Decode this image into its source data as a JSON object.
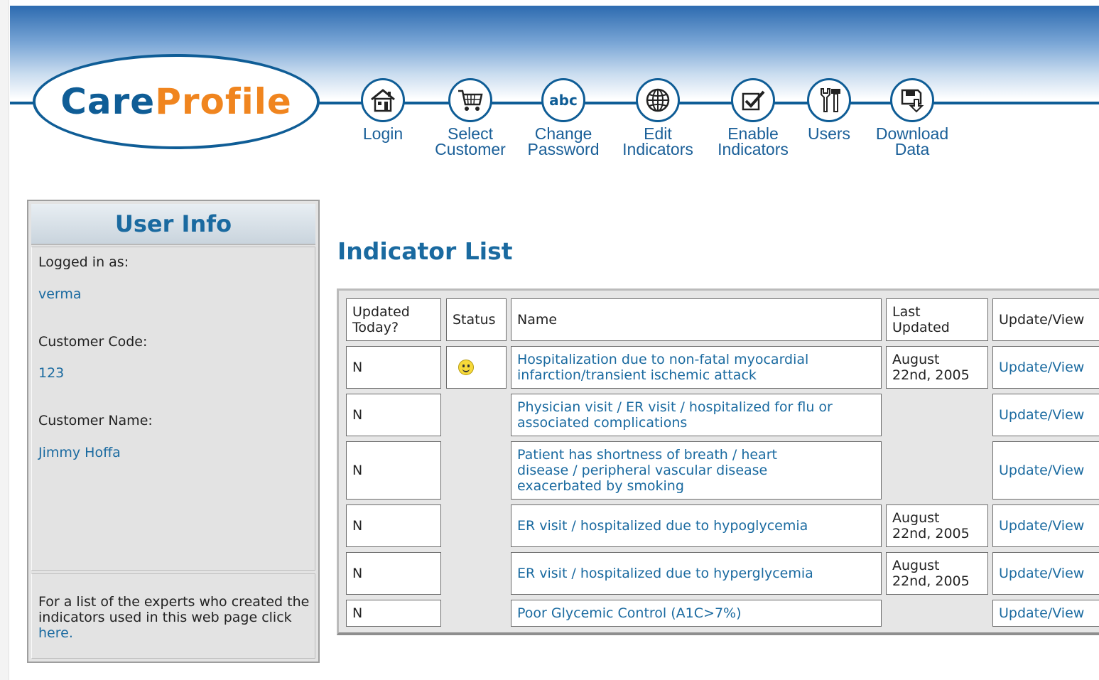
{
  "brand": {
    "part1": "Care",
    "part2": "Profile"
  },
  "nav": [
    {
      "label": "Login",
      "icon": "house-icon"
    },
    {
      "label": "Select Customer",
      "icon": "shopping-cart-icon"
    },
    {
      "label": "Change Password",
      "icon": "abc-icon"
    },
    {
      "label": "Edit Indicators",
      "icon": "globe-icon"
    },
    {
      "label": "Enable Indicators",
      "icon": "checkbox-icon"
    },
    {
      "label": "Users",
      "icon": "tools-icon"
    },
    {
      "label": "Download Data",
      "icon": "disk-download-icon"
    }
  ],
  "user_info": {
    "title": "User Info",
    "logged_in_label": "Logged in as:",
    "logged_in_value": "verma",
    "customer_code_label": "Customer Code:",
    "customer_code_value": "123",
    "customer_name_label": "Customer Name:",
    "customer_name_value": "Jimmy Hoffa",
    "footnote_text": "For a list of the experts who created the indicators used in this web page click ",
    "footnote_link": "here."
  },
  "main": {
    "title": "Indicator List",
    "columns": [
      "Updated Today?",
      "Status",
      "Name",
      "Last Updated",
      "Update/View"
    ],
    "rows": [
      {
        "updated_today": "N",
        "status": "smiley",
        "name": "Hospitalization due to non-fatal myocardial infarction/transient ischemic attack",
        "last_updated": "August 22nd, 2005",
        "action": "Update/View"
      },
      {
        "updated_today": "N",
        "status": "",
        "name": "Physician visit / ER visit / hospitalized for flu or associated complications",
        "last_updated": "",
        "action": "Update/View"
      },
      {
        "updated_today": "N",
        "status": "",
        "name": "Patient has shortness of breath / heart disease / peripheral vascular disease exacerbated by smoking",
        "last_updated": "",
        "action": "Update/View"
      },
      {
        "updated_today": "N",
        "status": "",
        "name": "ER visit / hospitalized due to hypoglycemia",
        "last_updated": "August 22nd, 2005",
        "action": "Update/View"
      },
      {
        "updated_today": "N",
        "status": "",
        "name": "ER visit / hospitalized due to hyperglycemia",
        "last_updated": "August 22nd, 2005",
        "action": "Update/View"
      },
      {
        "updated_today": "N",
        "status": "",
        "name": "Poor Glycemic Control (A1C>7%)",
        "last_updated": "",
        "action": "Update/View"
      }
    ]
  },
  "colors": {
    "brand_blue": "#0f5d96",
    "brand_orange": "#f0851f",
    "link_blue": "#1a6aa0"
  }
}
